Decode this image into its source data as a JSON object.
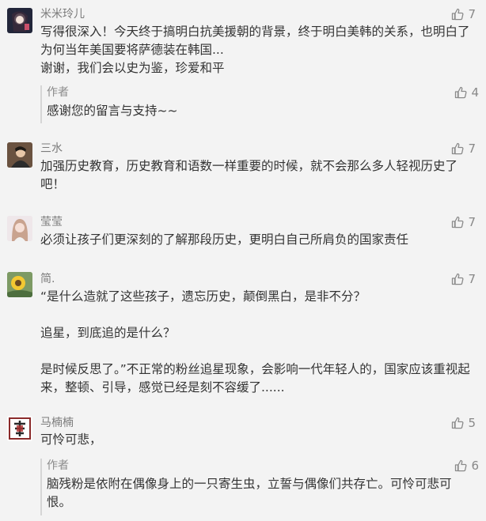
{
  "comments": [
    {
      "name": "米米玲儿",
      "likes": "7",
      "text": "写得很深入！今天终于搞明白抗美援朝的背景，终于明白美韩的关系，也明白了为何当年美国要将萨德装在韩国...\n谢谢，我们会以史为鉴，珍爱和平",
      "reply": {
        "name": "作者",
        "likes": "4",
        "text": "感谢您的留言与支持~~"
      }
    },
    {
      "name": "三水",
      "likes": "7",
      "text": "加强历史教育，历史教育和语数一样重要的时候，就不会那么多人轻视历史了吧！"
    },
    {
      "name": "莹莹",
      "likes": "7",
      "text": "必须让孩子们更深刻的了解那段历史，更明白自己所肩负的国家责任"
    },
    {
      "name": "简.",
      "likes": "7",
      "text": "“是什么造就了这些孩子，遗忘历史，颠倒黑白，是非不分？\n\n追星，到底追的是什么？\n\n是时候反思了。”不正常的粉丝追星现象，会影响一代年轻人的，国家应该重视起来，整顿、引导，感觉已经是刻不容缓了......"
    },
    {
      "name": "马楠楠",
      "likes": "5",
      "text": "可怜可悲，",
      "reply": {
        "name": "作者",
        "likes": "6",
        "text": "脑残粉是依附在偶像身上的一只寄生虫，立誓与偶像们共存亡。可怜可悲可恨。"
      }
    }
  ],
  "icons": {
    "like": "thumbs-up-icon"
  },
  "colors": {
    "background": "#f3f3f3",
    "name": "#7b7b7b",
    "text": "#333333"
  }
}
